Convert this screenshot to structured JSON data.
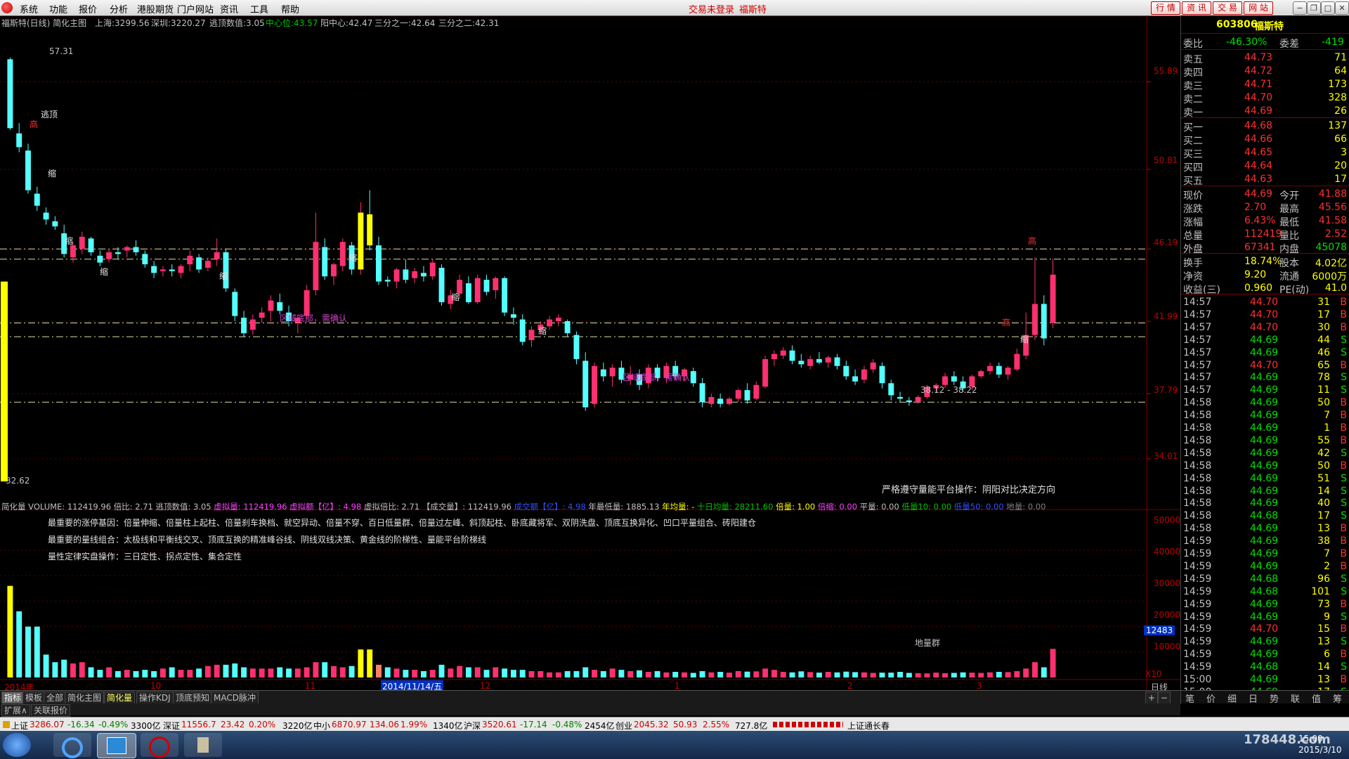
{
  "menu": {
    "items": [
      "系统",
      "功能",
      "报价",
      "分析",
      "港股期货",
      "门户网站",
      "资讯",
      "工具",
      "帮助"
    ],
    "center_status": "交易未登录",
    "center_name": "福斯特",
    "right_buttons": [
      "行 情",
      "资 讯",
      "交 易",
      "网 站"
    ],
    "window_buttons": [
      "−",
      "❐",
      "□",
      "✕"
    ]
  },
  "chart_header": {
    "title": "福斯特(日线) 简化主图",
    "sh_label": "上海:",
    "sh_value": "3299.56",
    "sz_label": "深圳:",
    "sz_value": "3220.27",
    "escape_label": "逃顶数值:",
    "escape_value": "3.05",
    "center_label": "中心位:",
    "center_value": "43.57",
    "yang_label": "阳中心:",
    "yang_value": "42.47",
    "third1_label": "三分之一:",
    "third1_value": "42.64",
    "third2_label": "三分之二:",
    "third2_value": "42.31"
  },
  "annotations": {
    "high_top": "57.31",
    "low_bottom": "32.62",
    "top_mark": "逃顶",
    "high_mark": "高",
    "shrink_mark": "缩",
    "region_bottom_1": "区域底部，需确认",
    "region_bottom_2": "区域底部，需确认",
    "range_label": "38.12 - 38.22",
    "advice": "严格遵守量能平台操作：阴阳对比决定方向",
    "ground_group": "地量群"
  },
  "price_axis": [
    "55.89",
    "50.81",
    "46.19",
    "41.99",
    "37.79",
    "34.01"
  ],
  "volume_axis": [
    "50000",
    "40000",
    "30000",
    "20000",
    "10000",
    "X10"
  ],
  "volume_cursor": "12483",
  "date_axis": [
    "2014年",
    "10",
    "11",
    "2014/11/14/五",
    "12",
    "1",
    "2",
    "3"
  ],
  "period_label": "日线",
  "volume_header": {
    "name": "简化量",
    "volume": "VOLUME: 112419.96",
    "ratio": "倍比: 2.71",
    "escape": "逃顶数值: 3.05",
    "virtual": "虚拟量: 112419.96",
    "virtual_amount": "虚拟额【亿】: 4.98",
    "virtual_ratio": "虚拟倍比: 2.71",
    "deal_vol": "【成交量】: 112419.96",
    "deal_amount": "成交额【亿】: 4.98",
    "year_low": "年最低量: 1885.13",
    "year_avg": "年均量: -",
    "ten_avg": "十日均量: 28211.60",
    "bei": "倍量: 1.00",
    "beisuo": "倍缩: 0.00",
    "ping": "平量: 0.00",
    "low10": "低量10: 0.00",
    "low50": "低量50: 0.00",
    "ground": "地量: 0.00"
  },
  "volume_notes": [
    "最重要的涨停基因：倍量伸缩、倍量柱上起柱、倍量刹车换档、就空异动、倍量不穿、百日低量群、倍量过左峰、斜顶起柱、卧底藏将军、双阴洗盘、顶底互换异化、凹口平量组合、砖阳建仓",
    "最重要的量线组合：太极线和平衡线交叉、顶底互换的精准峰谷线、阴线双线决策、黄金线的阶梯性、量能平台阶梯线",
    "量性定律实盘操作：三日定性、拐点定性、集合定性"
  ],
  "tabs": [
    "指标",
    "模板",
    "全部",
    "简化主图",
    "简化量",
    "操作KDJ",
    "顶底预知",
    "MACD脉冲"
  ],
  "tabs2": [
    "扩展∧",
    "关联报价"
  ],
  "quote": {
    "code": "603806",
    "name": "福斯特",
    "weibi_label": "委比",
    "weibi_value": "-46.30%",
    "weicha_label": "委差",
    "weicha_value": "-419",
    "sell": [
      {
        "label": "卖五",
        "price": "44.73",
        "vol": "71"
      },
      {
        "label": "卖四",
        "price": "44.72",
        "vol": "64"
      },
      {
        "label": "卖三",
        "price": "44.71",
        "vol": "173"
      },
      {
        "label": "卖二",
        "price": "44.70",
        "vol": "328"
      },
      {
        "label": "卖一",
        "price": "44.69",
        "vol": "26"
      }
    ],
    "buy": [
      {
        "label": "买一",
        "price": "44.68",
        "vol": "137"
      },
      {
        "label": "买二",
        "price": "44.66",
        "vol": "66"
      },
      {
        "label": "买三",
        "price": "44.65",
        "vol": "3"
      },
      {
        "label": "买四",
        "price": "44.64",
        "vol": "20"
      },
      {
        "label": "买五",
        "price": "44.63",
        "vol": "17"
      }
    ],
    "stats": [
      {
        "l1": "现价",
        "v1": "44.69",
        "l2": "今开",
        "v2": "41.88"
      },
      {
        "l1": "涨跌",
        "v1": "2.70",
        "l2": "最高",
        "v2": "45.56"
      },
      {
        "l1": "涨幅",
        "v1": "6.43%",
        "l2": "最低",
        "v2": "41.58"
      },
      {
        "l1": "总量",
        "v1": "112419",
        "l2": "量比",
        "v2": "2.52"
      },
      {
        "l1": "外盘",
        "v1": "67341",
        "l2": "内盘",
        "v2": "45078"
      }
    ],
    "stats2": [
      {
        "l1": "换手",
        "v1": "18.74%",
        "l2": "股本",
        "v2": "4.02亿"
      },
      {
        "l1": "净资",
        "v1": "9.20",
        "l2": "流通",
        "v2": "6000万"
      },
      {
        "l1": "收益(三)",
        "v1": "0.960",
        "l2": "PE(动)",
        "v2": "41.0"
      }
    ],
    "ticks": [
      [
        "14:57",
        "44.70",
        "31",
        "B"
      ],
      [
        "14:57",
        "44.70",
        "17",
        "B"
      ],
      [
        "14:57",
        "44.70",
        "30",
        "B"
      ],
      [
        "14:57",
        "44.69",
        "44",
        "S"
      ],
      [
        "14:57",
        "44.69",
        "46",
        "S"
      ],
      [
        "14:57",
        "44.70",
        "65",
        "B"
      ],
      [
        "14:57",
        "44.69",
        "78",
        "S"
      ],
      [
        "14:57",
        "44.69",
        "11",
        "S"
      ],
      [
        "14:58",
        "44.69",
        "50",
        "B"
      ],
      [
        "14:58",
        "44.69",
        "7",
        "B"
      ],
      [
        "14:58",
        "44.69",
        "1",
        "B"
      ],
      [
        "14:58",
        "44.69",
        "55",
        "B"
      ],
      [
        "14:58",
        "44.69",
        "42",
        "S"
      ],
      [
        "14:58",
        "44.69",
        "50",
        "B"
      ],
      [
        "14:58",
        "44.69",
        "51",
        "S"
      ],
      [
        "14:58",
        "44.69",
        "14",
        "S"
      ],
      [
        "14:58",
        "44.69",
        "40",
        "S"
      ],
      [
        "14:58",
        "44.68",
        "17",
        "S"
      ],
      [
        "14:58",
        "44.69",
        "13",
        "B"
      ],
      [
        "14:59",
        "44.69",
        "38",
        "B"
      ],
      [
        "14:59",
        "44.69",
        "7",
        "B"
      ],
      [
        "14:59",
        "44.69",
        "2",
        "B"
      ],
      [
        "14:59",
        "44.68",
        "96",
        "S"
      ],
      [
        "14:59",
        "44.68",
        "101",
        "S"
      ],
      [
        "14:59",
        "44.69",
        "73",
        "B"
      ],
      [
        "14:59",
        "44.69",
        "9",
        "S"
      ],
      [
        "14:59",
        "44.70",
        "15",
        "B"
      ],
      [
        "14:59",
        "44.69",
        "13",
        "S"
      ],
      [
        "14:59",
        "44.69",
        "6",
        "B"
      ],
      [
        "14:59",
        "44.68",
        "14",
        "S"
      ],
      [
        "15:00",
        "44.69",
        "13",
        "B"
      ],
      [
        "15:00",
        "44.69",
        "17",
        "S"
      ]
    ],
    "bottom_tabs": [
      "笔",
      "价",
      "细",
      "日",
      "势",
      "联",
      "值",
      "筹"
    ]
  },
  "status": {
    "sh_label": "上证",
    "sh_val": "3286.07",
    "sh_chg": "-16.34",
    "sh_pct": "-0.49%",
    "sh_amt": "3300亿",
    "sz_label": "深证",
    "sz_val": "11556.7",
    "sz_chg": "23.42",
    "sz_pct": "0.20%",
    "sz_amt": "3220亿",
    "zx_label": "中小",
    "zx_val": "6870.97",
    "zx_chg": "134.06",
    "zx_pct": "1.99%",
    "zx_amt": "1340亿",
    "hs_label": "沪深",
    "hs_val": "3520.61",
    "hs_chg": "-17.14",
    "hs_pct": "-0.48%",
    "hs_amt": "2454亿",
    "cy_label": "创业",
    "cy_val": "2045.32",
    "cy_chg": "50.93",
    "cy_pct": "2.55%",
    "cy_amt": "727.8亿",
    "news": "上证通长春"
  },
  "taskbar": {
    "time": "15:00",
    "date": "2015/3/10",
    "watermark": "178448.com"
  },
  "chart_data": {
    "type": "candlestick",
    "price_range": [
      31.6,
      58.6
    ],
    "candles": [
      [
        57.2,
        57.3,
        53.1,
        53.2
      ],
      [
        52.9,
        53.5,
        51.8,
        52.1
      ],
      [
        51.9,
        52.3,
        49.4,
        49.6
      ],
      [
        49.4,
        49.8,
        48.4,
        48.7
      ],
      [
        48.3,
        48.6,
        47.6,
        47.9
      ],
      [
        47.8,
        48.1,
        47.3,
        47.5
      ],
      [
        47.1,
        47.6,
        45.7,
        45.9
      ],
      [
        45.7,
        46.6,
        45.4,
        46.4
      ],
      [
        46.2,
        47.2,
        45.9,
        46.9
      ],
      [
        46.8,
        46.9,
        45.8,
        46.0
      ],
      [
        45.8,
        46.1,
        45.2,
        45.4
      ],
      [
        45.6,
        46.2,
        45.4,
        46.0
      ],
      [
        46.0,
        46.3,
        45.6,
        45.9
      ],
      [
        46.1,
        46.4,
        45.7,
        46.3
      ],
      [
        46.3,
        46.7,
        45.8,
        46.0
      ],
      [
        45.9,
        46.1,
        45.1,
        45.3
      ],
      [
        45.2,
        45.5,
        44.5,
        44.8
      ],
      [
        44.9,
        45.2,
        44.6,
        45.0
      ],
      [
        45.0,
        45.3,
        44.6,
        44.9
      ],
      [
        44.8,
        45.3,
        44.5,
        45.2
      ],
      [
        45.3,
        46.1,
        44.9,
        45.8
      ],
      [
        45.7,
        45.9,
        44.8,
        45.0
      ],
      [
        45.1,
        45.7,
        44.9,
        45.5
      ],
      [
        45.6,
        46.8,
        45.2,
        46.0
      ],
      [
        46.0,
        46.2,
        43.7,
        43.9
      ],
      [
        43.7,
        43.9,
        42.0,
        42.3
      ],
      [
        42.2,
        42.6,
        41.1,
        41.3
      ],
      [
        41.5,
        42.4,
        41.2,
        42.1
      ],
      [
        42.2,
        42.8,
        41.9,
        42.5
      ],
      [
        42.6,
        43.5,
        42.0,
        43.2
      ],
      [
        43.1,
        43.6,
        42.4,
        42.6
      ],
      [
        42.5,
        42.9,
        41.7,
        42.0
      ],
      [
        41.9,
        42.4,
        41.3,
        42.2
      ],
      [
        42.3,
        44.1,
        42.1,
        43.8
      ],
      [
        43.8,
        48.3,
        43.5,
        46.6
      ],
      [
        46.3,
        46.8,
        44.4,
        44.6
      ],
      [
        44.6,
        45.4,
        44.1,
        45.3
      ],
      [
        45.2,
        46.8,
        44.9,
        46.6
      ],
      [
        46.4,
        46.6,
        44.7,
        45.0
      ],
      [
        45.0,
        48.9,
        44.7,
        48.3
      ],
      [
        48.2,
        49.6,
        46.1,
        46.4
      ],
      [
        46.4,
        46.9,
        44.1,
        44.3
      ],
      [
        44.4,
        44.6,
        44.0,
        44.3
      ],
      [
        44.3,
        45.1,
        43.9,
        45.0
      ],
      [
        45.0,
        45.6,
        44.2,
        44.4
      ],
      [
        44.5,
        45.1,
        44.2,
        44.9
      ],
      [
        44.8,
        45.2,
        44.3,
        44.6
      ],
      [
        44.6,
        45.6,
        44.4,
        45.4
      ],
      [
        45.1,
        45.3,
        42.9,
        43.1
      ],
      [
        43.0,
        43.8,
        42.7,
        43.5
      ],
      [
        43.6,
        44.7,
        43.3,
        44.4
      ],
      [
        44.2,
        44.6,
        43.0,
        43.1
      ],
      [
        43.1,
        44.7,
        43.0,
        44.5
      ],
      [
        44.4,
        44.7,
        43.5,
        43.7
      ],
      [
        43.8,
        44.6,
        43.3,
        44.5
      ],
      [
        44.5,
        44.6,
        42.3,
        42.5
      ],
      [
        42.4,
        42.8,
        41.8,
        42.2
      ],
      [
        42.1,
        42.4,
        40.6,
        40.8
      ],
      [
        40.9,
        41.7,
        40.5,
        41.5
      ],
      [
        41.5,
        42.0,
        41.2,
        41.8
      ],
      [
        41.7,
        42.3,
        41.5,
        42.1
      ],
      [
        42.0,
        42.4,
        41.7,
        42.2
      ],
      [
        42.0,
        42.1,
        41.1,
        41.3
      ],
      [
        41.2,
        41.4,
        39.5,
        39.8
      ],
      [
        39.7,
        40.2,
        36.8,
        37.0
      ],
      [
        37.2,
        39.6,
        37.0,
        39.4
      ],
      [
        39.2,
        39.6,
        38.5,
        38.8
      ],
      [
        38.8,
        39.5,
        38.2,
        39.3
      ],
      [
        39.3,
        39.7,
        38.4,
        38.6
      ],
      [
        38.6,
        39.4,
        38.3,
        38.9
      ],
      [
        38.9,
        39.2,
        38.0,
        38.3
      ],
      [
        38.4,
        39.5,
        38.1,
        39.3
      ],
      [
        39.3,
        39.5,
        38.5,
        38.7
      ],
      [
        38.7,
        39.6,
        38.4,
        39.4
      ],
      [
        39.4,
        39.7,
        38.6,
        38.8
      ],
      [
        38.8,
        39.3,
        38.5,
        39.2
      ],
      [
        39.1,
        39.3,
        38.2,
        38.4
      ],
      [
        38.4,
        38.7,
        37.0,
        37.3
      ],
      [
        37.2,
        37.8,
        37.0,
        37.6
      ],
      [
        37.5,
        37.8,
        37.0,
        37.2
      ],
      [
        37.2,
        37.6,
        37.1,
        37.5
      ],
      [
        37.5,
        38.1,
        37.3,
        38.0
      ],
      [
        38.0,
        38.4,
        37.2,
        37.4
      ],
      [
        37.5,
        38.5,
        37.4,
        38.3
      ],
      [
        38.2,
        40.0,
        38.1,
        39.8
      ],
      [
        39.8,
        40.3,
        39.4,
        40.1
      ],
      [
        40.0,
        40.5,
        39.8,
        40.3
      ],
      [
        40.3,
        40.6,
        39.5,
        39.7
      ],
      [
        39.7,
        40.1,
        39.3,
        39.5
      ],
      [
        39.4,
        40.0,
        39.2,
        39.8
      ],
      [
        39.8,
        40.2,
        39.5,
        39.6
      ],
      [
        39.6,
        40.0,
        39.3,
        39.9
      ],
      [
        39.9,
        40.1,
        39.2,
        39.4
      ],
      [
        39.4,
        39.7,
        38.6,
        38.8
      ],
      [
        38.8,
        39.2,
        38.3,
        38.5
      ],
      [
        38.6,
        39.4,
        38.4,
        39.2
      ],
      [
        39.2,
        39.8,
        39.0,
        39.6
      ],
      [
        39.4,
        39.6,
        38.1,
        38.4
      ],
      [
        38.4,
        38.6,
        37.4,
        37.7
      ],
      [
        37.6,
        37.9,
        37.3,
        37.5
      ],
      [
        37.4,
        37.6,
        37.1,
        37.3
      ],
      [
        37.3,
        37.7,
        37.2,
        37.6
      ],
      [
        37.6,
        38.3,
        37.5,
        38.2
      ],
      [
        38.1,
        38.4,
        37.9,
        38.3
      ],
      [
        38.3,
        39.0,
        38.1,
        38.8
      ],
      [
        38.8,
        39.1,
        38.3,
        38.5
      ],
      [
        38.5,
        38.8,
        37.9,
        38.1
      ],
      [
        38.2,
        38.9,
        38.0,
        38.8
      ],
      [
        38.8,
        39.2,
        38.7,
        39.1
      ],
      [
        39.1,
        39.6,
        38.9,
        39.4
      ],
      [
        39.4,
        39.6,
        38.7,
        38.9
      ],
      [
        38.9,
        39.4,
        38.6,
        39.3
      ],
      [
        39.2,
        40.4,
        39.1,
        40.1
      ],
      [
        40.0,
        42.5,
        39.8,
        41.2
      ],
      [
        41.2,
        45.7,
        40.9,
        43.0
      ],
      [
        43.0,
        43.5,
        40.6,
        41.0
      ],
      [
        41.9,
        45.6,
        41.6,
        44.7
      ]
    ],
    "volumes": [
      36000,
      26000,
      20000,
      20000,
      9000,
      6000,
      7000,
      5500,
      6000,
      4000,
      3000,
      4000,
      2500,
      3000,
      2500,
      3000,
      2500,
      3500,
      4000,
      3000,
      3000,
      3500,
      4500,
      5000,
      5000,
      5500,
      4000,
      3500,
      3500,
      3500,
      4000,
      3500,
      3500,
      4000,
      6000,
      6000,
      4500,
      4000,
      4500,
      11000,
      11000,
      5000,
      4000,
      3500,
      3000,
      3000,
      2500,
      3000,
      5000,
      3500,
      4500,
      4000,
      4000,
      3000,
      4000,
      3500,
      3000,
      3000,
      2500,
      2500,
      2000,
      2000,
      2500,
      2500,
      4000,
      3000,
      2500,
      3500,
      3000,
      2500,
      2800,
      2200,
      2500,
      2000,
      2200,
      2000,
      1800,
      2500,
      2000,
      2200,
      1900,
      2500,
      2300,
      2400,
      3500,
      3000,
      2200,
      2000,
      2400,
      2100,
      1900,
      2200,
      2000,
      2300,
      2100,
      2000,
      1800,
      1900,
      1900,
      2200,
      1800,
      1700,
      1600,
      1900,
      1700,
      1800,
      2000,
      1900,
      1800,
      2000,
      2200,
      2100,
      2500,
      3500,
      6000,
      4000,
      11241
    ],
    "volume_range": [
      0,
      58000
    ]
  }
}
